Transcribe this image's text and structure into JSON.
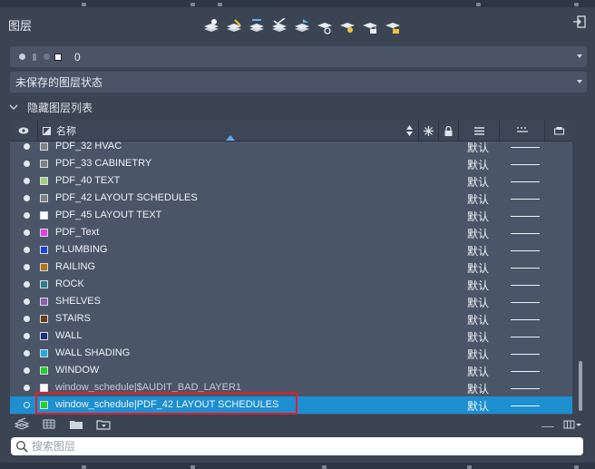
{
  "palette": {
    "title": "图层"
  },
  "toolbar": {
    "icons": [
      "new-layer-icon",
      "new-layer-vp-frozen-icon",
      "delete-layer-icon",
      "set-current-icon",
      "layer-match-icon",
      "layer-isolate-icon",
      "layer-on-icon",
      "layer-lock-icon",
      "layer-unlock-icon"
    ]
  },
  "current_layer": {
    "name": "0"
  },
  "layer_state": {
    "value": "未保存的图层状态"
  },
  "filter": {
    "label": "隐藏图层列表"
  },
  "table": {
    "headers": {
      "name": "名称"
    },
    "rows": [
      {
        "name": "PDF_32 HVAC",
        "color": "#808080",
        "lineweight": "默认",
        "bulb": "on",
        "xref": false,
        "selected": false
      },
      {
        "name": "PDF_33 CABINETRY",
        "color": "#808080",
        "lineweight": "默认",
        "bulb": "on",
        "xref": false,
        "selected": false
      },
      {
        "name": "PDF_40 TEXT",
        "color": "#9ed27a",
        "lineweight": "默认",
        "bulb": "on",
        "xref": false,
        "selected": false
      },
      {
        "name": "PDF_42 LAYOUT SCHEDULES",
        "color": "#808080",
        "lineweight": "默认",
        "bulb": "on",
        "xref": false,
        "selected": false
      },
      {
        "name": "PDF_45 LAYOUT TEXT",
        "color": "#ffffff",
        "lineweight": "默认",
        "bulb": "on",
        "xref": false,
        "selected": false
      },
      {
        "name": "PDF_Text",
        "color": "#e23fe0",
        "lineweight": "默认",
        "bulb": "on",
        "xref": false,
        "selected": false
      },
      {
        "name": "PLUMBING",
        "color": "#1d3fe0",
        "lineweight": "默认",
        "bulb": "on",
        "xref": false,
        "selected": false
      },
      {
        "name": "RAILING",
        "color": "#b37417",
        "lineweight": "默认",
        "bulb": "on",
        "xref": false,
        "selected": false
      },
      {
        "name": "ROCK",
        "color": "#2a7c8c",
        "lineweight": "默认",
        "bulb": "on",
        "xref": false,
        "selected": false
      },
      {
        "name": "SHELVES",
        "color": "#8a5fae",
        "lineweight": "默认",
        "bulb": "on",
        "xref": false,
        "selected": false
      },
      {
        "name": "STAIRS",
        "color": "#6a3a10",
        "lineweight": "默认",
        "bulb": "on",
        "xref": false,
        "selected": false
      },
      {
        "name": "WALL",
        "color": "#1f2f7a",
        "lineweight": "默认",
        "bulb": "on",
        "xref": false,
        "selected": false
      },
      {
        "name": "WALL SHADING",
        "color": "#22a7e6",
        "lineweight": "默认",
        "bulb": "on",
        "xref": false,
        "selected": false
      },
      {
        "name": "WINDOW",
        "color": "#22d02a",
        "lineweight": "默认",
        "bulb": "on",
        "xref": false,
        "selected": false
      },
      {
        "name": "window_schedule|$AUDIT_BAD_LAYER1",
        "color": "#ffffff",
        "lineweight": "默认",
        "bulb": "on",
        "xref": true,
        "selected": false
      },
      {
        "name": "window_schedule|PDF_42 LAYOUT SCHEDULES",
        "color": "#22d02a",
        "lineweight": "默认",
        "bulb": "off",
        "xref": false,
        "selected": true
      }
    ]
  },
  "search": {
    "placeholder": "搜索图层"
  },
  "colors": {
    "selection": "#1d8fd1",
    "highlight_box": "#e0202a"
  }
}
